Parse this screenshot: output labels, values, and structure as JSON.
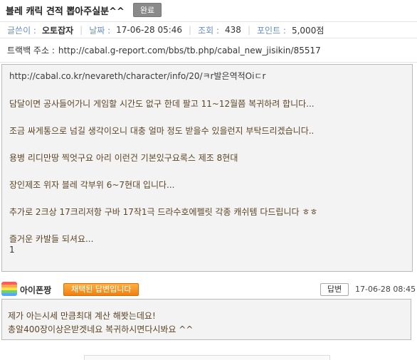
{
  "post": {
    "title": "블레 캐릭 견적 뽑아주실분^^",
    "status": "완료",
    "meta": {
      "author_label": "글쓴이 :",
      "author": "오토잡자",
      "date_label": "날짜 :",
      "date": "17-06-28 05:46",
      "views_label": "조회 :",
      "views": "438",
      "points_label": "포인트 :",
      "points": "5,000점"
    },
    "trackback_label": "트랙백 주소 :",
    "trackback_url": "http://cabal.g-report.com/bbs/tb.php/cabal_new_jisikin/85517",
    "body": {
      "url": "http://cabal.co.kr/nevareth/character/info/20/ㅋr발은역적Oiㄷr",
      "lines": [
        "담달이면 공사들어가니 게임할 시간도 없구 한데 팔고 11~12월쯤 복귀하려 합니다...",
        "조금 싸게통으로 넘길 생각이오니 대충 얼마 정도 받을수 있을런지 부탁드리겠습니다..",
        "용병 리디만땅 찍엇구요  아리 이런건 기본있구요록스 제조 8현대",
        "장인제조 위자 블레 각부위 6~7현대 입니다...",
        "추가로 2크상 17크리저항 구바 17작1극 드라수호에펠릿 각종 캐쉬템 다드립니다 ㅎㅎ",
        "즐거운 카발들 되셔요..."
      ],
      "last": "1"
    }
  },
  "answer": {
    "nickname": "아이폰짱",
    "chosen_label": "채택된 답변입니다",
    "reply_button": "답변",
    "date": "17-06-28 08:45",
    "lines": [
      "제가 아는시세 만큼최대 계산 해봣는데요!",
      "총알400장이상은받겟네요 복귀하시면다시봐요 ^^"
    ]
  },
  "colors": {
    "meta_label": "#6b8fc2",
    "body_text": "#5b4626",
    "chosen_badge": "#f07f10",
    "box_bg": "#f3f3f3"
  }
}
